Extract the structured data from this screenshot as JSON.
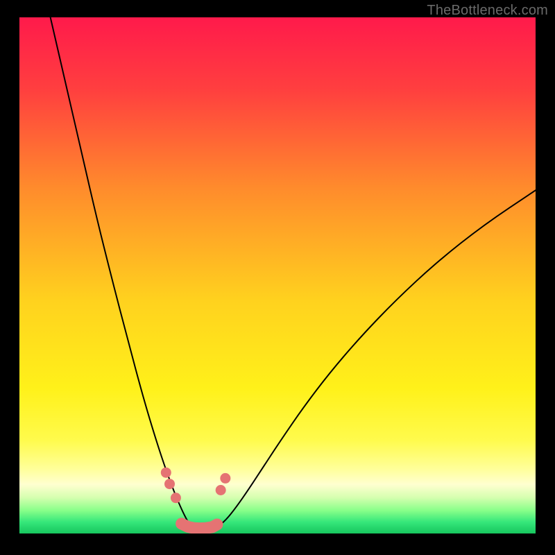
{
  "watermark": "TheBottleneck.com",
  "chart_data": {
    "type": "line",
    "title": "",
    "xlabel": "",
    "ylabel": "",
    "xlim": [
      0,
      100
    ],
    "ylim": [
      0,
      100
    ],
    "gradient_stops": [
      {
        "offset": 0.0,
        "color": "#ff1a4b"
      },
      {
        "offset": 0.14,
        "color": "#ff3f3f"
      },
      {
        "offset": 0.33,
        "color": "#ff8b2c"
      },
      {
        "offset": 0.55,
        "color": "#ffd21e"
      },
      {
        "offset": 0.72,
        "color": "#fff11a"
      },
      {
        "offset": 0.82,
        "color": "#fffb4d"
      },
      {
        "offset": 0.875,
        "color": "#ffff9a"
      },
      {
        "offset": 0.905,
        "color": "#ffffd0"
      },
      {
        "offset": 0.93,
        "color": "#d6ffb0"
      },
      {
        "offset": 0.955,
        "color": "#8aff8a"
      },
      {
        "offset": 0.978,
        "color": "#35e77a"
      },
      {
        "offset": 1.0,
        "color": "#17c65e"
      }
    ],
    "series": [
      {
        "name": "left-branch",
        "x": [
          6,
          9,
          12,
          15,
          18,
          21,
          24,
          26.5,
          28.5,
          30.2,
          31.5,
          32.5,
          33.3
        ],
        "y": [
          100,
          87,
          74,
          61,
          49,
          37.5,
          26.3,
          18,
          12,
          7.5,
          4.5,
          2.5,
          1.3
        ]
      },
      {
        "name": "right-branch",
        "x": [
          38.5,
          40,
          42,
          44.5,
          47.5,
          51,
          55,
          60,
          66,
          73,
          81,
          90,
          100
        ],
        "y": [
          1.4,
          2.6,
          5.1,
          8.7,
          13.3,
          18.6,
          24.4,
          31,
          38,
          45.3,
          52.7,
          59.8,
          66.5
        ]
      },
      {
        "name": "valley-floor",
        "x": [
          33.3,
          34.2,
          35.2,
          36.2,
          37.2,
          38.0,
          38.5
        ],
        "y": [
          1.3,
          0.75,
          0.55,
          0.55,
          0.65,
          0.95,
          1.4
        ]
      }
    ],
    "markers_left": {
      "x": [
        28.4,
        29.1,
        30.3
      ],
      "y": [
        11.8,
        9.6,
        6.9
      ]
    },
    "markers_right": {
      "x": [
        39.0,
        39.9
      ],
      "y": [
        8.4,
        10.7
      ]
    },
    "valley_dots": {
      "x": [
        31.4,
        32.6,
        33.8,
        35.0,
        36.2,
        37.4,
        38.3
      ],
      "y": [
        1.9,
        1.3,
        1.05,
        1.0,
        1.05,
        1.25,
        1.75
      ]
    }
  }
}
